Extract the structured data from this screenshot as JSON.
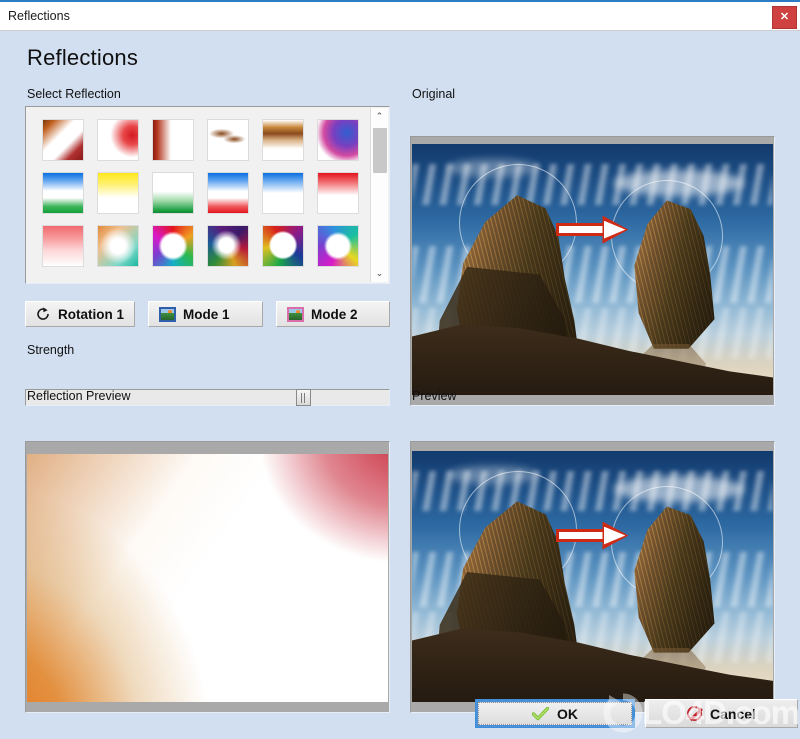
{
  "window": {
    "title": "Reflections",
    "close_label": "✕",
    "close_icon": "close-icon",
    "accent_color": "#2b7cc4",
    "close_color": "#cf4040",
    "background_color": "#d2dff0"
  },
  "page": {
    "heading": "Reflections"
  },
  "labels": {
    "select_reflection": "Select Reflection",
    "original": "Original",
    "strength": "Strength",
    "reflection_preview": "Reflection Preview",
    "preview": "Preview"
  },
  "thumbnails": [
    {
      "name": "diagonal-brown-white",
      "css": "linear-gradient(135deg,#7a3a10 0%,#c0601f 14%,#ffffff 40%,#ffffff 62%,#b03030 80%,#8b1a1a 100%)"
    },
    {
      "name": "white-red-corner",
      "css": "radial-gradient(circle at 86% 38%, #d41a22 0%, #e8484a 22%, #ffffff 52%), linear-gradient(200deg,#ffffff 60%,#e9b24f 100%)"
    },
    {
      "name": "red-brown-left-edge",
      "css": "linear-gradient(90deg,#8c1b12 0%,#b3341c 10%,#ffffff 45%,#ffffff 100%), linear-gradient(0deg,#7a2a12 0%,#ffffff 40%)"
    },
    {
      "name": "brown-brush-strokes",
      "css": "radial-gradient(ellipse 18px 7px at 34% 34%, #8a4a1c 0%, rgba(255,255,255,0) 70%), radial-gradient(ellipse 16px 6px at 66% 48%, #8a4a1c 0%, rgba(255,255,255,0) 70%), #ffffff"
    },
    {
      "name": "horizontal-brown-band",
      "css": "linear-gradient(to bottom,#ffffff 0%,#c98a3e 18%,#8a4a1c 34%,#d8b184 50%,#ffffff 72%,#ffffff 100%)"
    },
    {
      "name": "blue-magenta-blob",
      "css": "radial-gradient(circle at 72% 32%, #2f5fd0 0%, #7a3fc0 34%, #d24aa0 58%, rgba(255,255,255,0) 78%), #ffffff"
    },
    {
      "name": "blue-white-green",
      "css": "linear-gradient(to bottom,#0b6fe0 0%,#5ea3ef 18%,#ffffff 45%,#ffffff 62%,#3cb55a 84%,#14a03a 100%)"
    },
    {
      "name": "yellow-top-fade",
      "css": "linear-gradient(to bottom,#ffe81c 0%,#fff06a 26%,#ffffff 62%,#ffffff 100%)"
    },
    {
      "name": "white-green-bottom",
      "css": "linear-gradient(to bottom,#ffffff 0%,#ffffff 46%,#9ed9a8 70%,#23a348 92%,#0f8a34 100%)"
    },
    {
      "name": "blue-white-red",
      "css": "linear-gradient(to bottom,#0b6fe0 0%,#63a6ef 20%,#ffffff 46%,#ffffff 62%,#f0585c 84%,#e4141c 100%)"
    },
    {
      "name": "blue-top-white",
      "css": "linear-gradient(to bottom,#0b6fe0 0%,#6aaaf0 20%,#ffffff 50%,#ffffff 100%)"
    },
    {
      "name": "red-top-white",
      "css": "linear-gradient(to bottom,#e4141c 0%,#f06a6e 22%,#ffffff 56%,#ffffff 100%)"
    },
    {
      "name": "red-fade-down",
      "css": "linear-gradient(to bottom,#f06a6e 0%,#f79a9c 30%,#fdd8d9 62%,#ffffff 100%)"
    },
    {
      "name": "teal-orange-corners",
      "css": "radial-gradient(circle at 50% 50%, #ffffff 26%, rgba(255,255,255,0) 64%), linear-gradient(135deg,#e0893a 0%,#f0c090 30%,#7fd8c8 72%,#19b9a0 100%)"
    },
    {
      "name": "rainbow-ring-white-center",
      "css": "radial-gradient(circle at 50% 50%, #ffffff 40%, rgba(255,255,255,0) 52%), conic-gradient(from 0deg,#e4141c,#f0a020,#2db84a,#13b0c8,#7a3fd0,#d81ac8,#e4141c)"
    },
    {
      "name": "dark-rainbow-blur",
      "css": "radial-gradient(circle at 46% 48%, #ffffff 24%, rgba(255,255,255,0) 50%), conic-gradient(from 40deg,#3a1a6a,#b81a3a,#d8a020,#2d8a3a,#1a5a9a,#5a1a7a,#3a1a6a)"
    },
    {
      "name": "rainbow-circle-outline",
      "css": "radial-gradient(circle at 50% 48%, #ffffff 42%, rgba(255,255,255,0) 50%), conic-gradient(from 120deg,#1a3a9a,#19a84a,#e0c020,#d8201a,#8a1a8a,#1a3a9a)"
    },
    {
      "name": "magenta-cyan-ring",
      "css": "radial-gradient(circle at 50% 50%, #ffffff 38%, rgba(255,255,255,0) 50%), conic-gradient(from 200deg,#d81ac8,#7a3fd0,#2f8fe0,#19c0a0,#e8d820,#d81ac8)"
    }
  ],
  "scrollbar": {
    "up_arrow": "⌃",
    "down_arrow": "⌄",
    "up_icon": "chevron-up-icon",
    "down_icon": "chevron-down-icon"
  },
  "buttons": {
    "rotation": {
      "label": "Rotation 1",
      "icon": "rotation-icon"
    },
    "mode1": {
      "label": "Mode 1",
      "icon": "image-icon"
    },
    "mode2": {
      "label": "Mode 2",
      "icon": "image-icon"
    }
  },
  "slider": {
    "name": "strength-slider",
    "value_percent": 77
  },
  "footer": {
    "ok_label": "OK",
    "ok_icon": "check-icon",
    "cancel_label": "Cancel",
    "cancel_icon": "deny-icon"
  },
  "watermark": {
    "text": "LO4D.com",
    "logo_icon": "refresh-arrow-icon"
  }
}
